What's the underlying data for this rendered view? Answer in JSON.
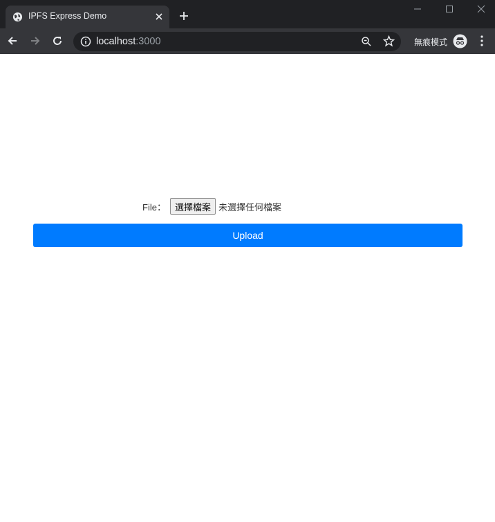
{
  "browser": {
    "tab_title": "IPFS Express Demo",
    "url_host": "localhost",
    "url_port": ":3000",
    "incognito_label": "無痕模式",
    "icons": [
      "globe-icon",
      "close-icon",
      "plus-icon",
      "minimize-icon",
      "maximize-icon",
      "window-close-icon",
      "back-icon",
      "forward-icon",
      "reload-icon",
      "info-icon",
      "zoom-icon",
      "star-icon",
      "incognito-icon",
      "menu-icon"
    ]
  },
  "form": {
    "file_label": "File：",
    "file_button_label": "選擇檔案",
    "file_status": "未選擇任何檔案",
    "upload_label": "Upload"
  },
  "colors": {
    "accent": "#007bff",
    "chrome_dark": "#202124",
    "chrome_tab": "#35363a"
  }
}
